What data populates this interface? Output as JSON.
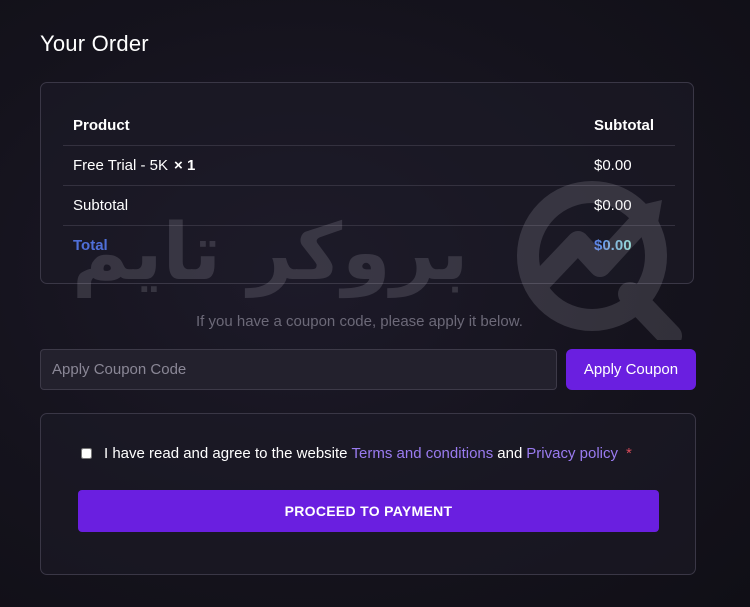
{
  "page": {
    "title": "Your Order"
  },
  "order": {
    "columns": {
      "product": "Product",
      "subtotal": "Subtotal"
    },
    "item": {
      "name": "Free Trial - 5K",
      "quantity": "× 1",
      "price": "$0.00"
    },
    "subtotal": {
      "label": "Subtotal",
      "value": "$0.00"
    },
    "total": {
      "label": "Total",
      "value": "$0.00"
    }
  },
  "coupon": {
    "hint": "If you have a coupon code, please apply it below.",
    "placeholder": "Apply Coupon Code",
    "value": "",
    "button_label": "Apply Coupon"
  },
  "terms": {
    "checked": false,
    "text_before": "I have read and agree to the website",
    "terms_link": "Terms and conditions",
    "connector": "and",
    "privacy_link": "Privacy policy",
    "required_mark": "*"
  },
  "payment": {
    "button_label": "PROCEED TO PAYMENT"
  },
  "watermark": {
    "text": "بروکر تایم",
    "logo_icon": "broker-time-logo-icon"
  },
  "colors": {
    "accent": "#6a1fe0",
    "link": "#9a7bf0",
    "total_label": "#4f6fd8",
    "required": "#d94b5a"
  }
}
